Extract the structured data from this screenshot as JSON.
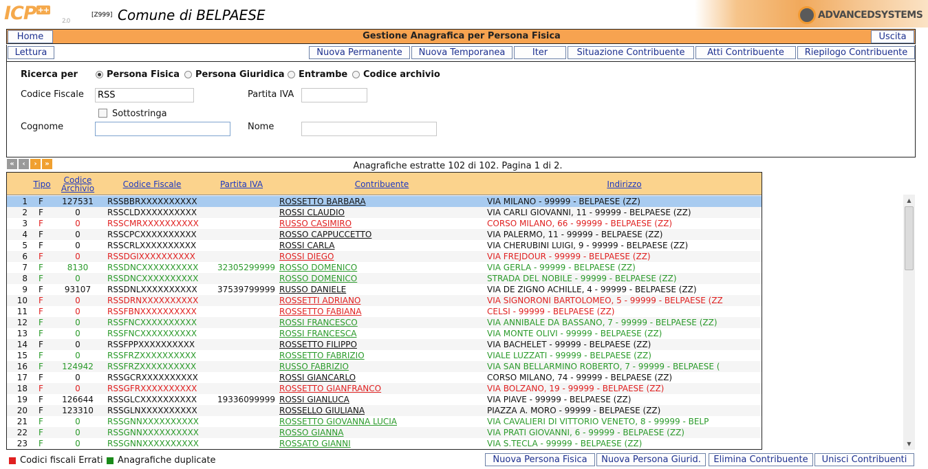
{
  "header": {
    "logo_text": "ICP",
    "logo_badge": "++",
    "logo_version": "2.0",
    "ente_code": "[Z999]",
    "ente_name": "Comune di BELPAESE",
    "brand": "ADVANCEDSYSTEMS"
  },
  "titlebar": {
    "home_label": "Home",
    "title": "Gestione Anagrafica per Persona Fisica",
    "exit_label": "Uscita"
  },
  "actions": {
    "lettura": "Lettura",
    "nuova_permanente": "Nuova Permanente",
    "nuova_temporanea": "Nuova Temporanea",
    "iter": "Iter",
    "situazione": "Situazione Contribuente",
    "atti": "Atti Contribuente",
    "riepilogo": "Riepilogo Contribuente"
  },
  "search": {
    "ricerca_per": "Ricerca per",
    "options": [
      "Persona Fisica",
      "Persona Giuridica",
      "Entrambe",
      "Codice archivio"
    ],
    "selected": "Persona Fisica",
    "codice_fiscale_label": "Codice Fiscale",
    "codice_fiscale_value": "RSS",
    "partita_iva_label": "Partita IVA",
    "partita_iva_value": "",
    "sottostringa_label": "Sottostringa",
    "sottostringa_checked": false,
    "cognome_label": "Cognome",
    "cognome_value": "",
    "nome_label": "Nome",
    "nome_value": ""
  },
  "pager": {
    "info": "Anagrafiche estratte 102 di 102. Pagina 1 di 2."
  },
  "table": {
    "headers": {
      "tipo": "Tipo",
      "codice_archivio": "Codice Archivio",
      "codice_fiscale": "Codice Fiscale",
      "partita_iva": "Partita IVA",
      "contribuente": "Contribuente",
      "indirizzo": "Indirizzo"
    },
    "rows": [
      {
        "n": "1",
        "tipo": "F",
        "archivio": "127531",
        "cf": "RSSBBRXXXXXXXXXX",
        "iva": "",
        "nome": "ROSSETTO BARBARA",
        "indirizzo": "VIA MILANO - 99999 - BELPAESE (ZZ)",
        "status": "black",
        "selected": true
      },
      {
        "n": "2",
        "tipo": "F",
        "archivio": "0",
        "cf": "RSSCLDXXXXXXXXXX",
        "iva": "",
        "nome": "ROSSI CLAUDIO",
        "indirizzo": "VIA CARLI GIOVANNI, 11 - 99999 - BELPAESE (ZZ)",
        "status": "black"
      },
      {
        "n": "3",
        "tipo": "F",
        "archivio": "0",
        "cf": "RSSCMRXXXXXXXXXX",
        "iva": "",
        "nome": "RUSSO CASIMIRO",
        "indirizzo": "CORSO MILANO, 66 - 99999 - BELPAESE (ZZ)",
        "status": "red"
      },
      {
        "n": "4",
        "tipo": "F",
        "archivio": "0",
        "cf": "RSSCPCXXXXXXXXXX",
        "iva": "",
        "nome": "ROSSO CAPPUCCETTO",
        "indirizzo": "VIA PALERMO, 11 - 99999 - BELPAESE (ZZ)",
        "status": "black"
      },
      {
        "n": "5",
        "tipo": "F",
        "archivio": "0",
        "cf": "RSSCRLXXXXXXXXXX",
        "iva": "",
        "nome": "ROSSI CARLA",
        "indirizzo": "VIA CHERUBINI LUIGI, 9 - 99999 - BELPAESE (ZZ)",
        "status": "black"
      },
      {
        "n": "6",
        "tipo": "F",
        "archivio": "0",
        "cf": "RSSDGIXXXXXXXXXX",
        "iva": "",
        "nome": "ROSSI DIEGO",
        "indirizzo": "VIA FREJDOUR - 99999 - BELPAESE (ZZ)",
        "status": "red"
      },
      {
        "n": "7",
        "tipo": "F",
        "archivio": "8130",
        "cf": "RSSDNCXXXXXXXXXX",
        "iva": "32305299999",
        "nome": "ROSSO DOMENICO",
        "indirizzo": "VIA GERLA - 99999 - BELPAESE (ZZ)",
        "status": "green"
      },
      {
        "n": "8",
        "tipo": "F",
        "archivio": "0",
        "cf": "RSSDNCXXXXXXXXXX",
        "iva": "",
        "nome": "ROSSO DOMENICO",
        "indirizzo": "STRADA DEL NOBILE - 99999 - BELPAESE (ZZ)",
        "status": "green"
      },
      {
        "n": "9",
        "tipo": "F",
        "archivio": "93107",
        "cf": "RSSDNLXXXXXXXXXX",
        "iva": "37539799999",
        "nome": "RUSSO DANIELE",
        "indirizzo": "VIA DE ZIGNO ACHILLE, 4 - 99999 - BELPAESE (ZZ)",
        "status": "black"
      },
      {
        "n": "10",
        "tipo": "F",
        "archivio": "0",
        "cf": "RSSDRNXXXXXXXXXX",
        "iva": "",
        "nome": "ROSSETTI ADRIANO",
        "indirizzo": "VIA SIGNORONI BARTOLOMEO, 5 - 99999 - BELPAESE (ZZ",
        "status": "red"
      },
      {
        "n": "11",
        "tipo": "F",
        "archivio": "0",
        "cf": "RSSFBNXXXXXXXXXX",
        "iva": "",
        "nome": "ROSSETTO FABIANA",
        "indirizzo": "CELSI - 99999 - BELPAESE (ZZ)",
        "status": "red"
      },
      {
        "n": "12",
        "tipo": "F",
        "archivio": "0",
        "cf": "RSSFNCXXXXXXXXXX",
        "iva": "",
        "nome": "ROSSI FRANCESCO",
        "indirizzo": "VIA ANNIBALE DA BASSANO, 7 - 99999 - BELPAESE (ZZ)",
        "status": "green"
      },
      {
        "n": "13",
        "tipo": "F",
        "archivio": "0",
        "cf": "RSSFNCXXXXXXXXXX",
        "iva": "",
        "nome": "ROSSI FRANCESCA",
        "indirizzo": "VIA MONTE OLIVI - 99999 - BELPAESE (ZZ)",
        "status": "green"
      },
      {
        "n": "14",
        "tipo": "F",
        "archivio": "0",
        "cf": "RSSFPPXXXXXXXXXX",
        "iva": "",
        "nome": "ROSSETTO FILIPPO",
        "indirizzo": "VIA BACHELET - 99999 - BELPAESE (ZZ)",
        "status": "black"
      },
      {
        "n": "15",
        "tipo": "F",
        "archivio": "0",
        "cf": "RSSFRZXXXXXXXXXX",
        "iva": "",
        "nome": "ROSSETTO FABRIZIO",
        "indirizzo": "VIALE LUZZATI - 99999 - BELPAESE (ZZ)",
        "status": "green"
      },
      {
        "n": "16",
        "tipo": "F",
        "archivio": "124942",
        "cf": "RSSFRZXXXXXXXXXX",
        "iva": "",
        "nome": "RUSSO FABRIZIO",
        "indirizzo": "VIA SAN BELLARMINO ROBERTO, 7 - 99999 - BELPAESE (",
        "status": "green"
      },
      {
        "n": "17",
        "tipo": "F",
        "archivio": "0",
        "cf": "RSSGCRXXXXXXXXXX",
        "iva": "",
        "nome": "ROSSI GIANCARLO",
        "indirizzo": "CORSO MILANO, 74 - 99999 - BELPAESE (ZZ)",
        "status": "black"
      },
      {
        "n": "18",
        "tipo": "F",
        "archivio": "0",
        "cf": "RSSGFRXXXXXXXXXX",
        "iva": "",
        "nome": "ROSSETTO GIANFRANCO",
        "indirizzo": "VIA BOLZANO, 19 - 99999 - BELPAESE (ZZ)",
        "status": "red"
      },
      {
        "n": "19",
        "tipo": "F",
        "archivio": "126644",
        "cf": "RSSGLCXXXXXXXXXX",
        "iva": "19336099999",
        "nome": "ROSSI GIANLUCA",
        "indirizzo": "VIA PIAVE - 99999 - BELPAESE (ZZ)",
        "status": "black"
      },
      {
        "n": "20",
        "tipo": "F",
        "archivio": "123310",
        "cf": "RSSGLNXXXXXXXXXX",
        "iva": "",
        "nome": "ROSSELLO GIULIANA",
        "indirizzo": "PIAZZA A. MORO - 99999 - BELPAESE (ZZ)",
        "status": "black"
      },
      {
        "n": "21",
        "tipo": "F",
        "archivio": "0",
        "cf": "RSSGNNXXXXXXXXXX",
        "iva": "",
        "nome": "ROSSETTO GIOVANNA LUCIA",
        "indirizzo": "VIA CAVALIERI DI VITTORIO VENETO, 8 - 99999 - BELP",
        "status": "green"
      },
      {
        "n": "22",
        "tipo": "F",
        "archivio": "0",
        "cf": "RSSGNNXXXXXXXXXX",
        "iva": "",
        "nome": "ROSSO GIANNA",
        "indirizzo": "VIA PRATI GIOVANNI, 6 - 99999 - BELPAESE (ZZ)",
        "status": "green"
      },
      {
        "n": "23",
        "tipo": "F",
        "archivio": "0",
        "cf": "RSSGNNXXXXXXXXXX",
        "iva": "",
        "nome": "ROSSATO GIANNI",
        "indirizzo": "VIA S.TECLA - 99999 - BELPAESE (ZZ)",
        "status": "green"
      }
    ]
  },
  "footer": {
    "legend_errati": "Codici fiscali Errati",
    "legend_duplicate": "Anagrafiche duplicate",
    "nuova_fisica": "Nuova Persona Fisica",
    "nuova_giuridica": "Nuova Persona Giurid.",
    "elimina": "Elimina Contribuente",
    "unisci": "Unisci Contribuenti"
  },
  "colors": {
    "accent_orange": "#f7a350",
    "header_table": "#fbd38d",
    "error_red": "#e02020",
    "duplicate_green": "#2a9a2a",
    "link_blue": "#1a37c2",
    "selected_row": "#a8cbf0"
  }
}
